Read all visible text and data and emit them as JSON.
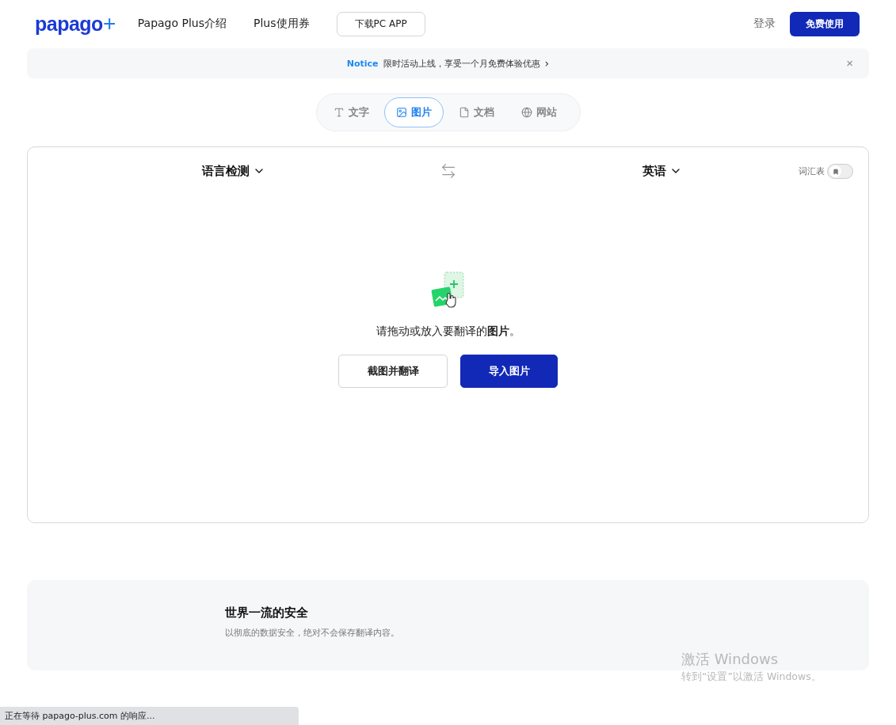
{
  "logo": {
    "name": "papago",
    "mark": "+"
  },
  "nav": [
    {
      "label": "Papago Plus介绍",
      "kind": "link"
    },
    {
      "label": "Plus使用券",
      "kind": "link"
    },
    {
      "label": "下载PC APP",
      "kind": "outline"
    }
  ],
  "login": "登录",
  "cta": "免费使用",
  "notice": {
    "tag": "Notice",
    "text": "限时活动上线，享受一个月免费体验优惠",
    "arrow": "›",
    "close": "×"
  },
  "tabs": [
    {
      "label": "文字",
      "selected": false
    },
    {
      "label": "图片",
      "selected": true
    },
    {
      "label": "文档",
      "selected": false
    },
    {
      "label": "网站",
      "selected": false
    }
  ],
  "translator": {
    "source": "语言检测",
    "target": "英语",
    "glossary": {
      "label": "词汇表",
      "on": false
    },
    "prompt": "请拖动或放入要翻译的**图片**。",
    "buttons": [
      {
        "label": "截图并翻译",
        "kind": "secondary"
      },
      {
        "label": "导入图片",
        "kind": "primary"
      }
    ]
  },
  "feature": {
    "title": "世界一流的安全",
    "text": "以彻底的数据安全，绝对不会保存翻译内容。"
  },
  "os_overlay": {
    "title": "激活 Windows",
    "text": "转到“设置”以激活 Windows。"
  },
  "status_bar": "正在等待 papago-plus.com 的响应..."
}
